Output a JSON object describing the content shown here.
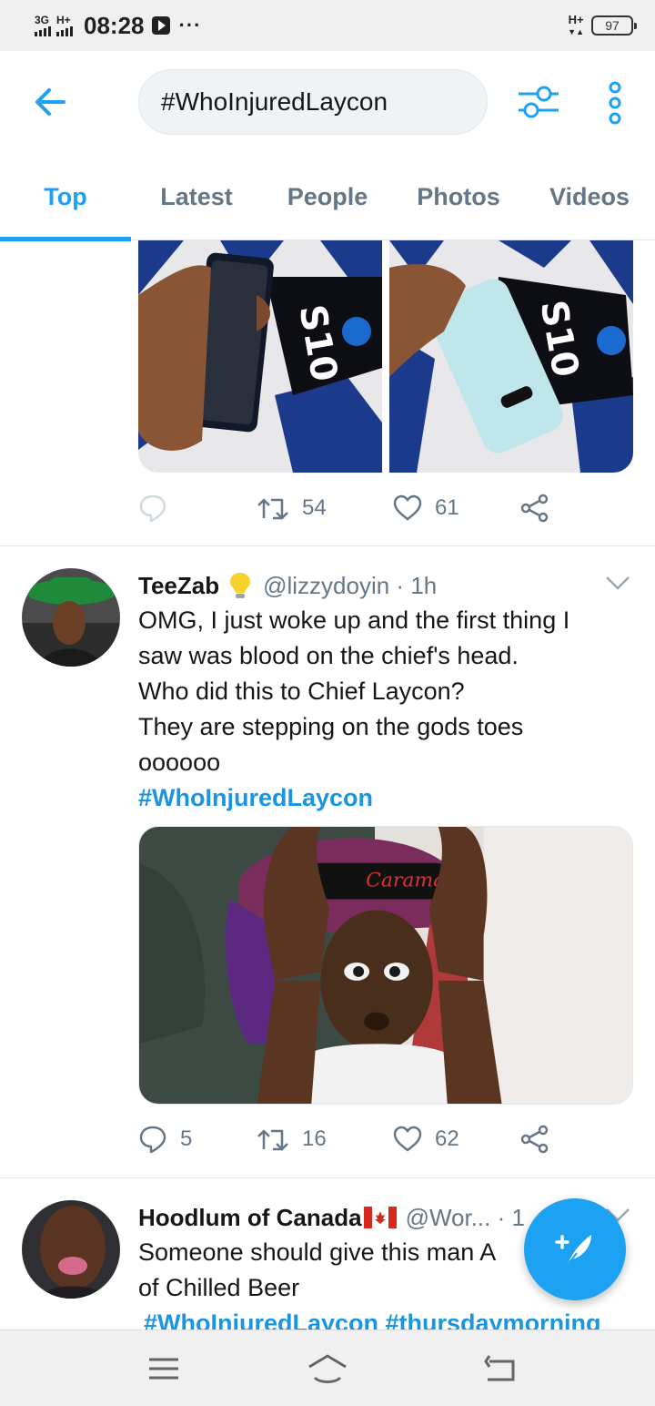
{
  "status_bar": {
    "net1": "3G",
    "net2": "H+",
    "time": "08:28",
    "overflow": "···",
    "net_right": "H+",
    "battery": "97"
  },
  "header": {
    "search_value": "#WhoInjuredLaycon",
    "back_icon": "arrow-left-icon",
    "filter_icon": "sliders-icon",
    "more_icon": "vertical-dots-icon"
  },
  "tabs": [
    {
      "label": "Top",
      "active": true
    },
    {
      "label": "Latest",
      "active": false
    },
    {
      "label": "People",
      "active": false
    },
    {
      "label": "Photos",
      "active": false
    },
    {
      "label": "Videos",
      "active": false
    }
  ],
  "tweet1": {
    "retweets": "54",
    "likes": "61"
  },
  "tweet2": {
    "name": "TeeZab",
    "badge_icon": "lightbulb-icon",
    "handle": "@lizzydoyin · 1h",
    "lines": [
      "OMG, I just woke up and the first thing I",
      "saw was blood on the chief's head.",
      "Who did this to Chief Laycon?",
      "They are stepping on the gods toes",
      "oooooo"
    ],
    "hashtag": "#WhoInjuredLaycon",
    "photo_text": "Carama",
    "replies": "5",
    "retweets": "16",
    "likes": "62"
  },
  "tweet3": {
    "name": "Hoodlum of Canada",
    "flag_icon": "canada-flag-icon",
    "handle": "@Wor... · 1",
    "lines": [
      "Someone should give this man A",
      "of Chilled Beer"
    ],
    "hashtags": "#WhoInjuredLaycon #thursdaymorning"
  },
  "colors": {
    "accent": "#1da1f2",
    "link": "#1b95e0",
    "muted": "#657786"
  }
}
